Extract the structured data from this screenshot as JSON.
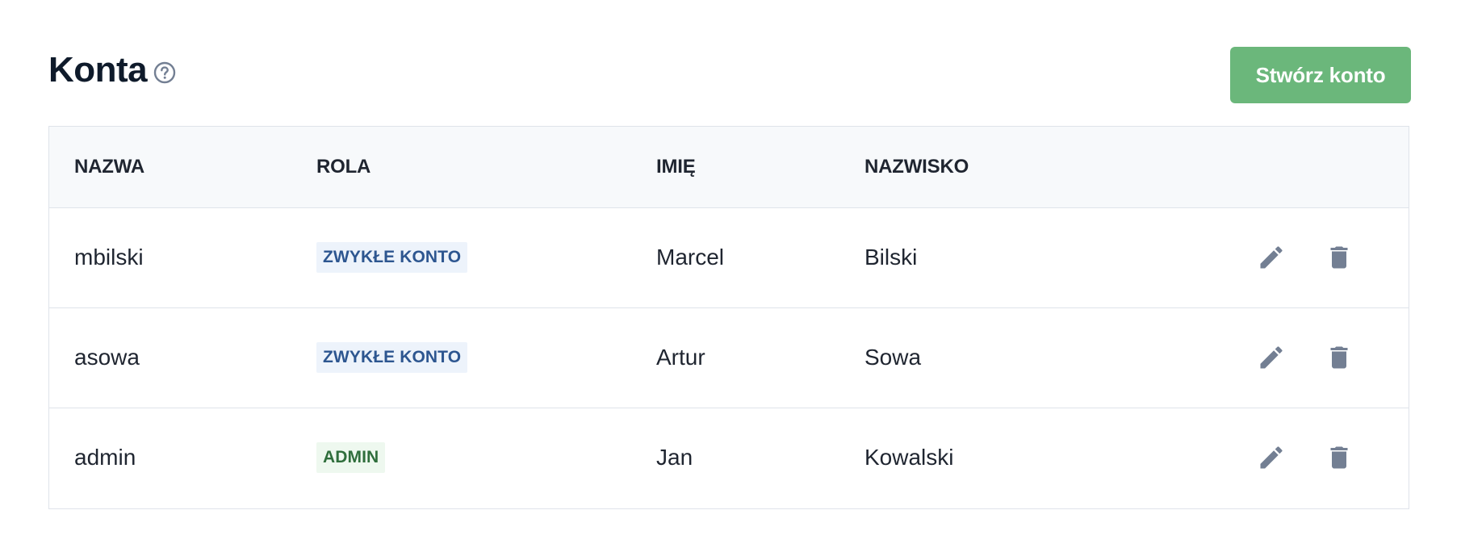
{
  "page": {
    "title": "Konta",
    "create_button_label": "Stwórz konto"
  },
  "table": {
    "headers": {
      "name": "NAZWA",
      "role": "ROLA",
      "first_name": "IMIĘ",
      "last_name": "NAZWISKO"
    },
    "rows": [
      {
        "name": "mbilski",
        "role": "ZWYKŁE KONTO",
        "role_type": "regular",
        "first_name": "Marcel",
        "last_name": "Bilski"
      },
      {
        "name": "asowa",
        "role": "ZWYKŁE KONTO",
        "role_type": "regular",
        "first_name": "Artur",
        "last_name": "Sowa"
      },
      {
        "name": "admin",
        "role": "ADMIN",
        "role_type": "admin",
        "first_name": "Jan",
        "last_name": "Kowalski"
      }
    ]
  },
  "icons": {
    "help": "help-circle-icon",
    "edit": "pencil-icon",
    "delete": "trash-icon"
  },
  "colors": {
    "accent_green": "#6bb77b",
    "icon_gray": "#737f93",
    "regular_badge_bg": "#edf3fb",
    "regular_badge_text": "#2d5690",
    "admin_badge_bg": "#eef8ef",
    "admin_badge_text": "#2f6e3c"
  }
}
